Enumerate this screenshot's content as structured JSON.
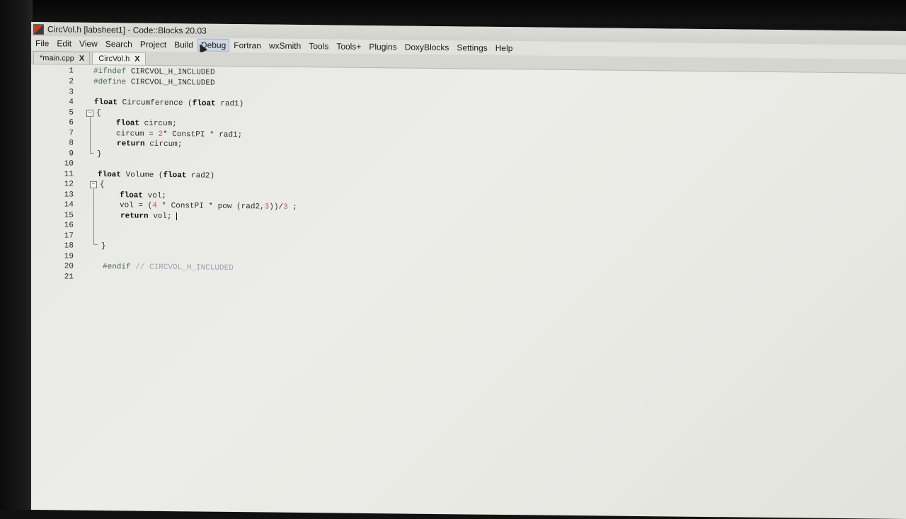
{
  "window": {
    "title": "CircVol.h [labsheet1] - Code::Blocks 20.03",
    "icon": "codeblocks-app-icon"
  },
  "menu": [
    {
      "label": "File"
    },
    {
      "label": "Edit"
    },
    {
      "label": "View"
    },
    {
      "label": "Search"
    },
    {
      "label": "Project"
    },
    {
      "label": "Build"
    },
    {
      "label": "Debug",
      "active": true
    },
    {
      "label": "Fortran"
    },
    {
      "label": "wxSmith"
    },
    {
      "label": "Tools"
    },
    {
      "label": "Tools+"
    },
    {
      "label": "Plugins"
    },
    {
      "label": "DoxyBlocks"
    },
    {
      "label": "Settings"
    },
    {
      "label": "Help"
    }
  ],
  "tabs": [
    {
      "label": "*main.cpp",
      "close": "X"
    },
    {
      "label": "CircVol.h",
      "close": "X",
      "active": true
    }
  ],
  "editor": {
    "line_numbers": [
      "1",
      "2",
      "3",
      "4",
      "5",
      "6",
      "7",
      "8",
      "9",
      "10",
      "11",
      "12",
      "13",
      "14",
      "15",
      "16",
      "17",
      "18",
      "19",
      "20",
      "21"
    ],
    "lines": {
      "l1a": "#ifndef",
      "l1b": " CIRCVOL_H_INCLUDED",
      "l2a": "#define",
      "l2b": " CIRCVOL_H_INCLUDED",
      "l4a": "float",
      "l4b": " Circumference (",
      "l4c": "float",
      "l4d": " rad1)",
      "l5": "{",
      "l6a": "float",
      "l6b": " circum;",
      "l7a": "circum = ",
      "l7b": "2",
      "l7c": "* ConstPI * rad1;",
      "l8a": "return",
      "l8b": " circum;",
      "l9": "}",
      "l11a": "float",
      "l11b": " Volume (",
      "l11c": "float",
      "l11d": " rad2)",
      "l12": "{",
      "l13a": "float",
      "l13b": " vol;",
      "l14a": "vol = (",
      "l14b": "4",
      "l14c": " * ConstPI * pow (rad2,",
      "l14d": "3",
      "l14e": "))/",
      "l14f": "3",
      "l14g": " ;",
      "l15a": "return",
      "l15b": " vol;",
      "l18": "}",
      "l20a": "#endif",
      "l20b": " // CIRCVOL_H_INCLUDED"
    }
  }
}
